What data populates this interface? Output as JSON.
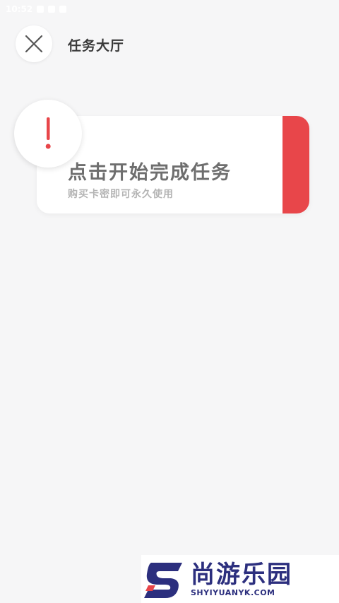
{
  "status_bar": {
    "time": "10:52"
  },
  "header": {
    "title": "任务大厅",
    "close_icon": "close-icon"
  },
  "task_card": {
    "title": "点击开始完成任务",
    "subtitle": "购买卡密即可永久使用",
    "accent_color": "#e8464a",
    "badge_icon": "exclamation-icon"
  },
  "watermark": {
    "name_cn": "尚游乐园",
    "domain": "SHYIYUANYK.COM",
    "color": "#2c2f7e"
  }
}
